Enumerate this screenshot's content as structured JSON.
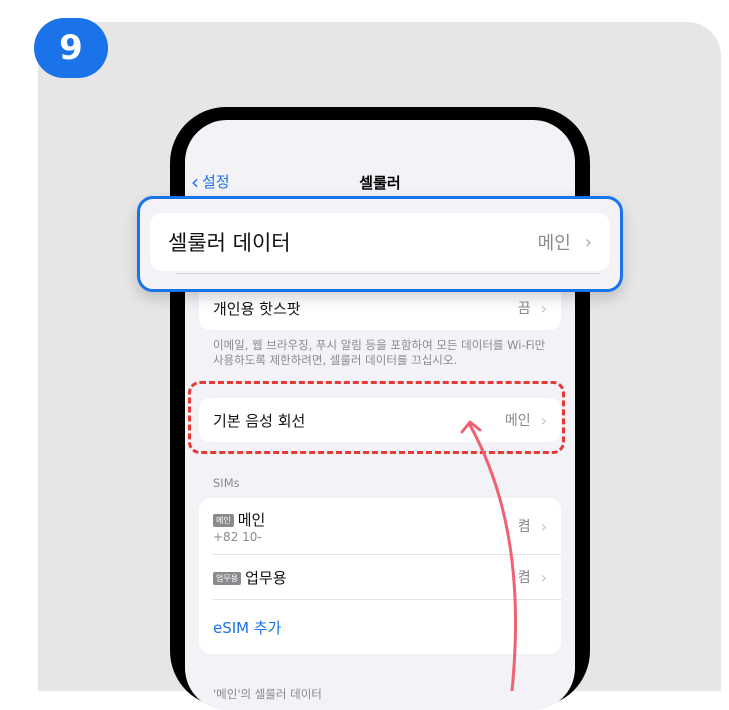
{
  "step": {
    "number": "9",
    "color": "#1a73e8"
  },
  "nav": {
    "back_label": "설정",
    "title": "셀룰러"
  },
  "highlighted_row": {
    "label": "셀룰러 데이터",
    "value": "메인"
  },
  "rows": {
    "hotspot": {
      "label": "개인용 핫스팟",
      "value": "끔"
    },
    "voice": {
      "label": "기본 음성 회선",
      "value": "메인"
    }
  },
  "footnote": "이메일, 웹 브라우징, 푸시 알림 등을 포함하여 모든 데이터를 Wi-Fi만 사용하도록 제한하려면, 셀룰러 데이터를 끄십시오.",
  "sims": {
    "header": "SIMs",
    "items": [
      {
        "tag": "메인",
        "label": "메인",
        "sub": "+82 10-",
        "value": "켬"
      },
      {
        "tag": "업무용",
        "label": "업무용",
        "sub": "",
        "value": "켬"
      }
    ],
    "add_label": "eSIM 추가"
  },
  "bottom_header": "'메인'의 셀룰러 데이터",
  "colors": {
    "accent": "#1a73e8",
    "dash": "#e53935",
    "arrow": "#f06272"
  }
}
